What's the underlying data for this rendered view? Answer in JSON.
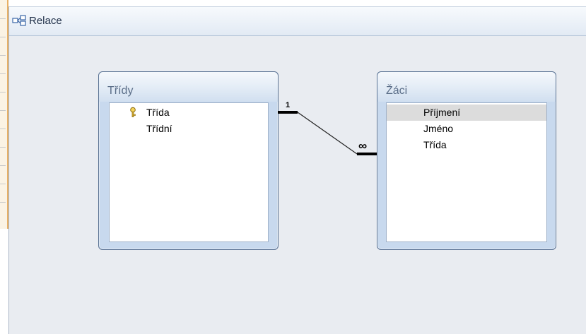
{
  "window": {
    "title": "Relace",
    "icon": "relationships-icon"
  },
  "tables": [
    {
      "name": "Třídy",
      "fields": [
        {
          "label": "Třída",
          "primary_key": true,
          "selected": false
        },
        {
          "label": "Třídní",
          "primary_key": false,
          "selected": false
        }
      ]
    },
    {
      "name": "Žáci",
      "fields": [
        {
          "label": "Příjmení",
          "primary_key": false,
          "selected": true
        },
        {
          "label": "Jméno",
          "primary_key": false,
          "selected": false
        },
        {
          "label": "Třída",
          "primary_key": false,
          "selected": false
        }
      ]
    }
  ],
  "relationship": {
    "from_table": "Třídy",
    "to_table": "Žáci",
    "one_side_label": "1",
    "many_side_label": "∞"
  },
  "colors": {
    "canvas": "#e9ecf1",
    "table_frame": "#c8d9ee",
    "selection": "#dcdcdc"
  }
}
